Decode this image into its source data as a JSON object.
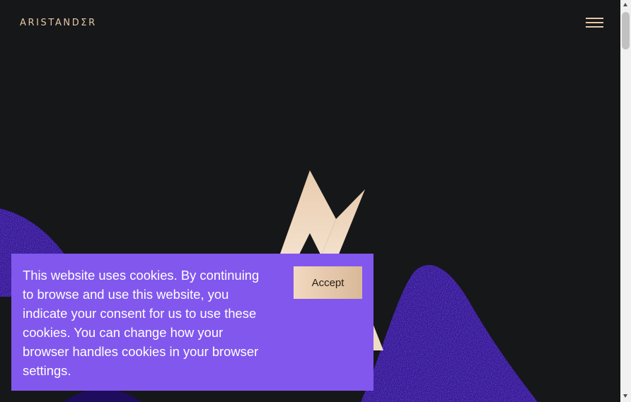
{
  "header": {
    "logo_text": "ARISTANDΣR",
    "menu_icon": "hamburger-menu-icon"
  },
  "hero": {
    "mark_icon": "aristander-a-mark-icon"
  },
  "cookie_banner": {
    "message": "This website uses cookies. By continuing to browse and use this website, you indicate your consent for us to use these cookies. You can change how your browser handles cookies in your browser settings.",
    "accept_label": "Accept"
  },
  "colors": {
    "background": "#161719",
    "gold": "#e4c7a7",
    "purple": "#8257ee",
    "accent_purple_dark": "#3a1aa8"
  }
}
